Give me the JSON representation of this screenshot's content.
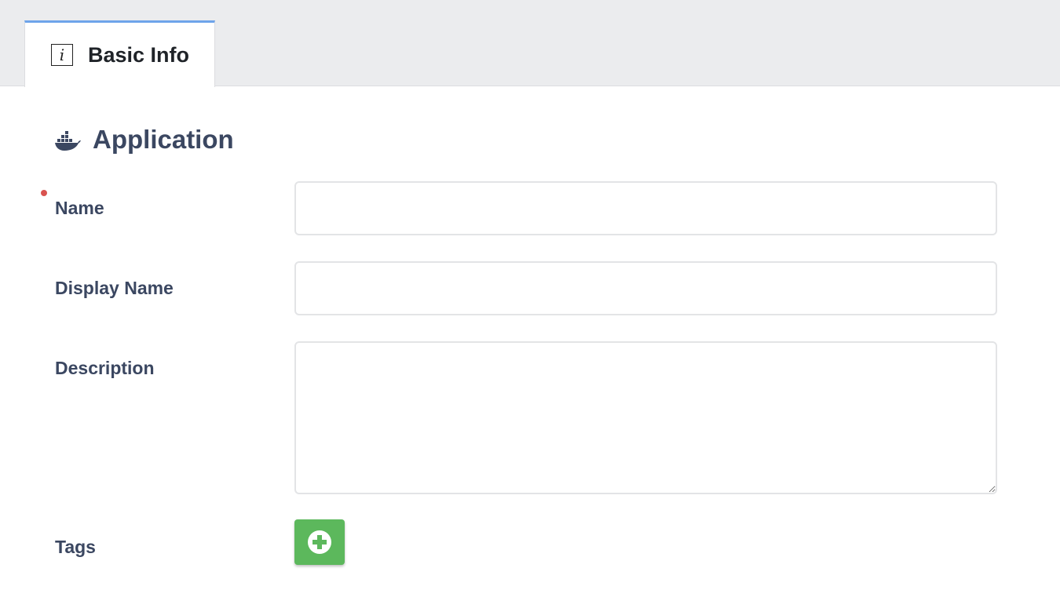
{
  "tabs": [
    {
      "label": "Basic Info",
      "icon": "info-icon",
      "active": true
    }
  ],
  "section": {
    "title": "Application",
    "icon": "docker-icon"
  },
  "form": {
    "name_label": "Name",
    "name_required": true,
    "name_value": "",
    "display_name_label": "Display Name",
    "display_name_value": "",
    "description_label": "Description",
    "description_value": "",
    "tags_label": "Tags",
    "add_tag_icon": "plus-circle-icon"
  },
  "colors": {
    "tab_accent": "#6ea4ea",
    "label_text": "#3b4761",
    "required_dot": "#d9534f",
    "add_button": "#5cb85c"
  }
}
